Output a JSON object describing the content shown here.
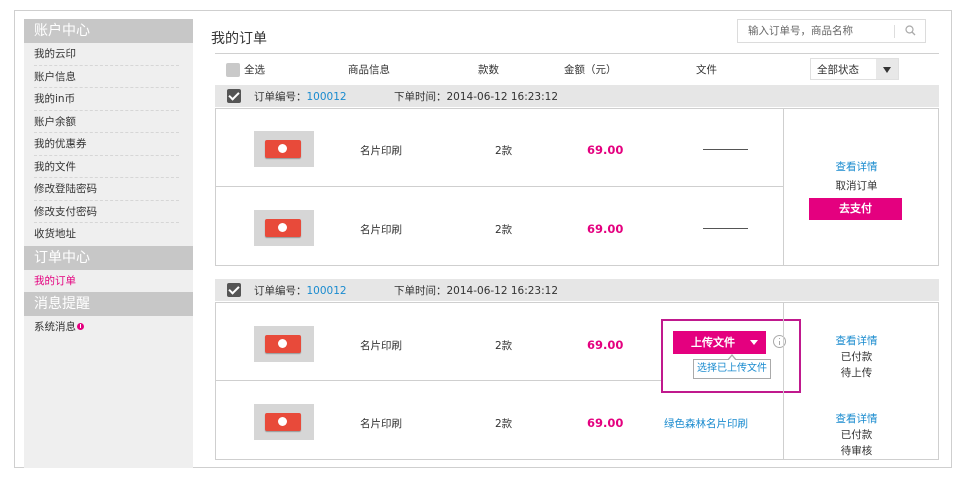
{
  "sidebar": {
    "account_center": {
      "title": "账户中心",
      "items": [
        "我的云印",
        "账户信息",
        "我的in币",
        "账户余额",
        "我的优惠券",
        "我的文件",
        "修改登陆密码",
        "修改支付密码",
        "收货地址"
      ]
    },
    "order_center": {
      "title": "订单中心",
      "items": [
        "我的订单"
      ]
    },
    "messages": {
      "title": "消息提醒",
      "items": [
        "系统消息"
      ]
    }
  },
  "page": {
    "title": "我的订单",
    "search_placeholder": "输入订单号，商品名称"
  },
  "table_header": {
    "select_all": "全选",
    "product_info": "商品信息",
    "quantity": "款数",
    "amount": "金额（元）",
    "file": "文件",
    "status_filter": "全部状态"
  },
  "orders": [
    {
      "label": "订单编号：",
      "number": "100012",
      "time": "下单时间：2014-06-12  16:23:12",
      "rows": [
        {
          "product": "名片印刷",
          "qty": "2款",
          "price": "69.00"
        },
        {
          "product": "名片印刷",
          "qty": "2款",
          "price": "69.00"
        }
      ],
      "actions": {
        "details": "查看详情",
        "cancel": "取消订单",
        "pay": "去支付"
      }
    },
    {
      "label": "订单编号：",
      "number": "100012",
      "time": "下单时间：2014-06-12  16:23:12",
      "rows": [
        {
          "product": "名片印刷",
          "qty": "2款",
          "price": "69.00",
          "upload": "上传文件",
          "choose_uploaded": "选择已上传文件",
          "details": "查看详情",
          "status1": "已付款",
          "status2": "待上传"
        },
        {
          "product": "名片印刷",
          "qty": "2款",
          "price": "69.00",
          "file_link": "绿色森林名片印刷",
          "details": "查看详情",
          "status1": "已付款",
          "status2": "待审核"
        }
      ]
    }
  ],
  "colors": {
    "accent": "#e4007f",
    "link": "#1a8bcf",
    "sidebar_bg": "#efefef",
    "sidebar_head": "#c7c7c7"
  }
}
